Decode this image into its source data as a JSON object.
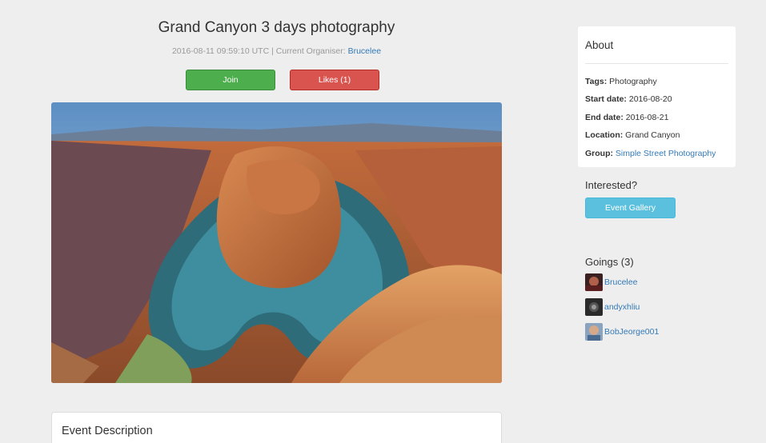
{
  "event": {
    "title": "Grand Canyon 3 days photography",
    "timestamp": "2016-08-11 09:59:10 UTC",
    "organiser_prefix": "| Current Organiser:",
    "organiser": "Brucelee"
  },
  "actions": {
    "join_label": "Join",
    "likes_label": "Likes (1)"
  },
  "description": {
    "title": "Event Description"
  },
  "about": {
    "title": "About",
    "tags_label": "Tags:",
    "tags_value": "Photography",
    "start_label": "Start date:",
    "start_value": "2016-08-20",
    "end_label": "End date:",
    "end_value": "2016-08-21",
    "location_label": "Location:",
    "location_value": "Grand Canyon",
    "group_label": "Group:",
    "group_value": "Simple Street Photography"
  },
  "interested": {
    "title": "Interested?",
    "gallery_label": "Event Gallery"
  },
  "goings": {
    "title": "Goings (3)",
    "users": [
      {
        "name": "Brucelee"
      },
      {
        "name": "andyxhliu"
      },
      {
        "name": "BobJeorge001"
      }
    ]
  },
  "colors": {
    "join": "#4cae4c",
    "likes": "#d9534f",
    "gallery": "#5bc0de",
    "link": "#337ab7"
  }
}
